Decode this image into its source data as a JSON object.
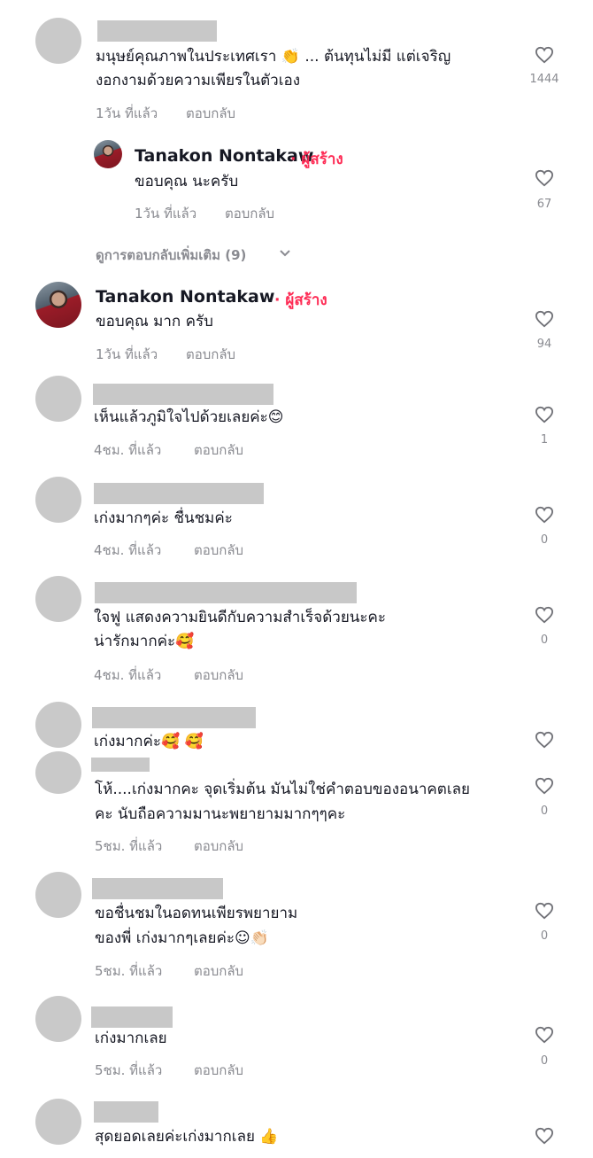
{
  "comments": [
    {
      "text1": "มนุษย์คุณภาพในประเทศเรา 👏 ... ต้นทุนไม่มี แต่เจริญ",
      "text2": "งอกงามด้วยความเพียรในตัวเอง",
      "time": "1วัน ที่แล้ว",
      "reply": "ตอบกลับ",
      "likes": "1444"
    },
    {
      "author": "Tanakon Nontakaw",
      "badge": "· ผู้สร้าง",
      "text1": "ขอบคุณ นะครับ",
      "time": "1วัน ที่แล้ว",
      "reply": "ตอบกลับ",
      "likes": "67"
    },
    {
      "author": "Tanakon Nontakaw",
      "badge": "· ผู้สร้าง",
      "text1": "ขอบคุณ มาก ครับ",
      "time": "1วัน ที่แล้ว",
      "reply": "ตอบกลับ",
      "likes": "94"
    },
    {
      "text1": "เห็นแล้วภูมิใจไปด้วยเลยค่ะ😊",
      "time": "4ชม. ที่แล้ว",
      "reply": "ตอบกลับ",
      "likes": "1"
    },
    {
      "text1": "เก่งมากๆค่ะ ชื่นชมค่ะ",
      "time": "4ชม. ที่แล้ว",
      "reply": "ตอบกลับ",
      "likes": "0"
    },
    {
      "text1": "ใจฟู แสดงความยินดีกับความสำเร็จด้วยนะคะ",
      "text2": "น่ารักมากค่ะ🥰",
      "time": "4ชม. ที่แล้ว",
      "reply": "ตอบกลับ",
      "likes": "0"
    },
    {
      "text1": "เก่งมากค่ะ🥰 🥰",
      "likes": ""
    },
    {
      "text1": "โห้....เก่งมากคะ จุดเริ่มต้น มันไม่ใช่คำตอบของอนาคตเลย",
      "text2": "คะ นับถือความมานะพยายามมากๆๆคะ",
      "time": "5ชม. ที่แล้ว",
      "reply": "ตอบกลับ",
      "likes": "0"
    },
    {
      "text1": "ขอชื่นชมในอดทนเพียรพยายาม",
      "text2": "ของพี่ เก่งมากๆเลยค่ะ☺👏🏻",
      "time": "5ชม. ที่แล้ว",
      "reply": "ตอบกลับ",
      "likes": "0"
    },
    {
      "text1": "เก่งมากเลย",
      "time": "5ชม. ที่แล้ว",
      "reply": "ตอบกลับ",
      "likes": "0"
    },
    {
      "text1": "สุดยอดเลยค่ะเก่งมากเลย 👍",
      "likes": ""
    }
  ],
  "more_replies": "ดูการตอบกลับเพิ่มเติม (9)",
  "icons": {
    "heart": "heart-outline-icon",
    "chevron": "chevron-down-icon"
  }
}
